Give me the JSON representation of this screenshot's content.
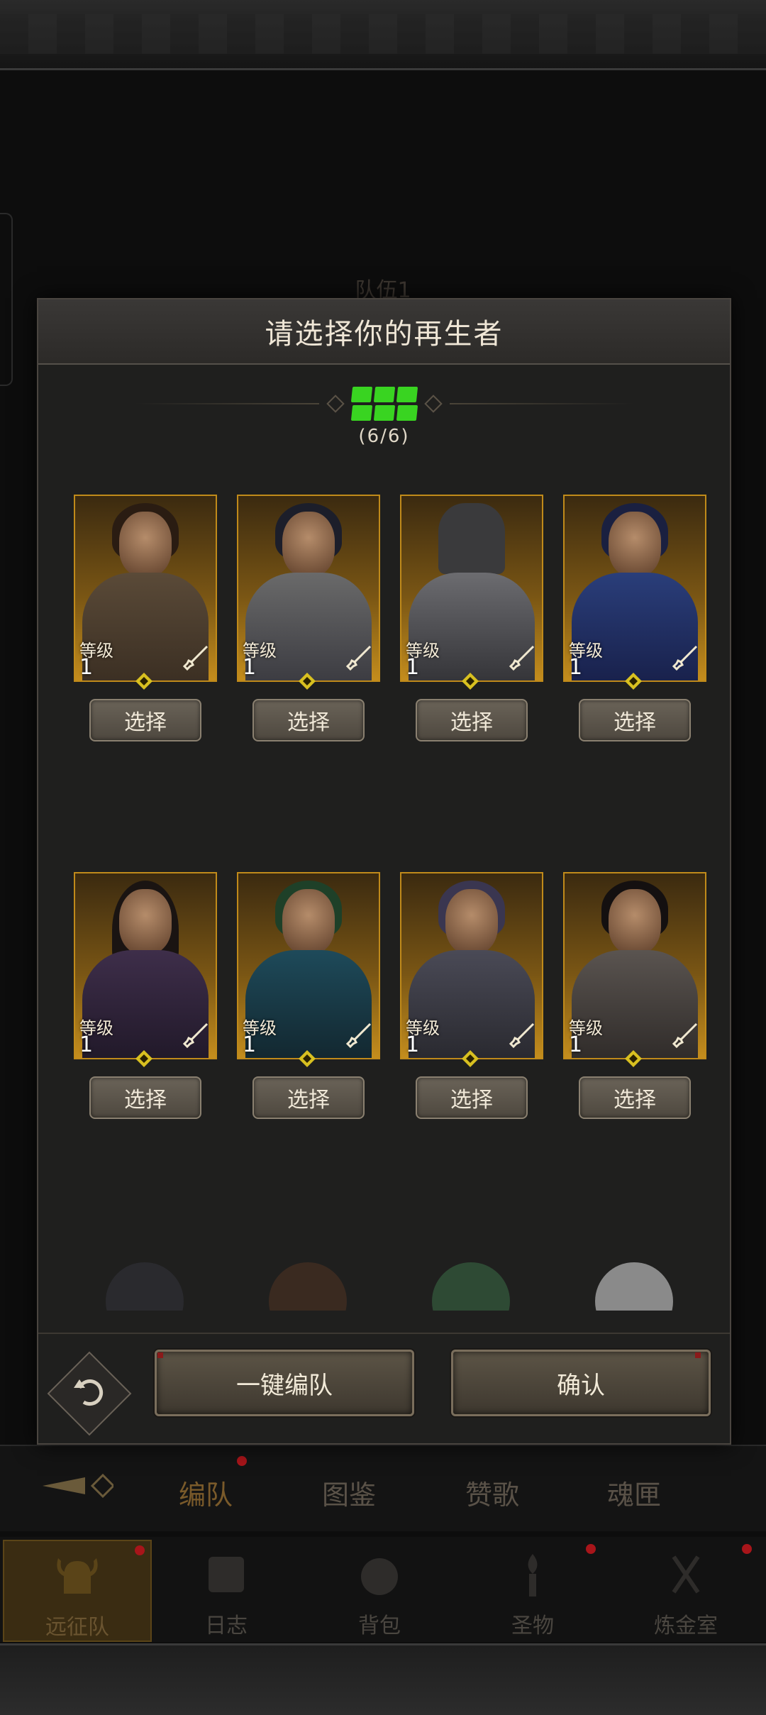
{
  "background": {
    "team_label": "队伍1",
    "sub_tabs": [
      "编队",
      "图鉴",
      "赞歌",
      "魂匣"
    ],
    "nav": [
      {
        "label": "远征队",
        "icon": "helmet-icon"
      },
      {
        "label": "日志",
        "icon": "scroll-icon"
      },
      {
        "label": "背包",
        "icon": "bag-icon"
      },
      {
        "label": "圣物",
        "icon": "torch-icon"
      },
      {
        "label": "炼金室",
        "icon": "alchemy-icon"
      }
    ]
  },
  "modal": {
    "title": "请选择你的再生者",
    "slot_count": "(6/6)",
    "level_label": "等级",
    "select_label": "选择",
    "auto_button": "一键编队",
    "confirm_button": "确认"
  },
  "heroes": [
    {
      "level": "1"
    },
    {
      "level": "1"
    },
    {
      "level": "1"
    },
    {
      "level": "1"
    },
    {
      "level": "1"
    },
    {
      "level": "1"
    },
    {
      "level": "1"
    },
    {
      "level": "1"
    }
  ],
  "colors": {
    "accent_gold": "#c08a1a",
    "slot_green": "#39d421",
    "notification_red": "#a8151a"
  }
}
